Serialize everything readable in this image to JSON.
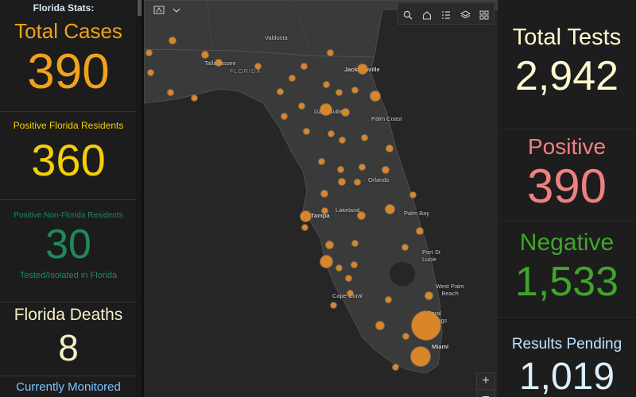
{
  "left": {
    "header": "Florida Stats:",
    "total_cases_label": "Total Cases",
    "total_cases_value": "390",
    "positive_residents_label": "Positive Florida Residents",
    "positive_residents_value": "360",
    "positive_nonres_label": "Positive Non-Florida Residents",
    "positive_nonres_value": "30",
    "positive_nonres_sub": "Tested/Isolated in Florida",
    "deaths_label": "Florida Deaths",
    "deaths_value": "8",
    "monitored_label": "Currently Monitored"
  },
  "right": {
    "total_tests_label": "Total Tests",
    "total_tests_value": "2,942",
    "positive_label": "Positive",
    "positive_value": "390",
    "negative_label": "Negative",
    "negative_value": "1,533",
    "pending_label": "Results Pending",
    "pending_value": "1,019"
  },
  "map": {
    "labels": [
      "Valdosta",
      "Tallahassee",
      "FLORIDA",
      "Jacksonville",
      "Gainesville",
      "Palm Coast",
      "Orlando",
      "Tampa",
      "Lakeland",
      "Palm Bay",
      "Port St Lucie",
      "West Palm Beach",
      "Cape Coral",
      "Coral Springs",
      "Miami"
    ],
    "zoom_in": "+",
    "zoom_out": "−"
  },
  "colors": {
    "total_cases": "#f0a21a",
    "residents": "#f5d000",
    "nonres": "#1f8a5a",
    "deaths_value": "#f5f0c8",
    "monitored": "#7fc4ff",
    "total_tests": "#fff8d0",
    "positive": "#f08080",
    "negative": "#3fa52a",
    "pending_label": "#bfe3ff",
    "pending_value": "#d8f0ff",
    "dot": "#d9862a"
  }
}
